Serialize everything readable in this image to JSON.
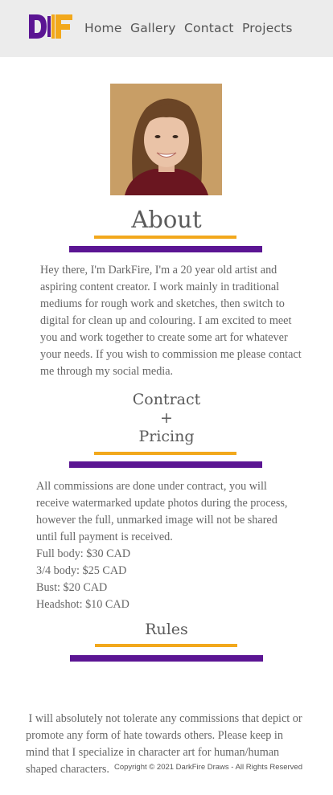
{
  "nav": {
    "links": [
      "Home",
      "Gallery",
      "Contact",
      "Projects"
    ],
    "logo_alt": "DF"
  },
  "colors": {
    "gold": "#f2a81c",
    "purple": "#5b1593",
    "navbar_bg": "#ececec"
  },
  "about": {
    "title": "About",
    "text": "Hey there, I'm DarkFire, I'm a 20 year old artist and aspiring content creator. I work mainly in traditional mediums for rough work and sketches, then switch to digital for clean up and colouring. I am excited to meet you and work together to create some art for whatever your needs. If you wish to commission me please contact me through my social media."
  },
  "contract": {
    "title_line1": "Contract",
    "title_line2": "+",
    "title_line3": "Pricing",
    "text": "All commissions are done under contract, you will receive watermarked update photos during the process, however the full, unmarked image will not be shared until full payment is received.",
    "prices": [
      "Full body: $30 CAD",
      "3/4 body: $25 CAD",
      "Bust: $20 CAD",
      "Headshot: $10 CAD"
    ]
  },
  "rules": {
    "title": "Rules",
    "text": " I will absolutely not tolerate any commissions that depict or promote any form of hate towards others. Please keep in mind that I specialize in character art for human/human shaped characters."
  },
  "footer": {
    "copyright": "Copyright © 2021 DarkFire Draws - All Rights Reserved"
  }
}
